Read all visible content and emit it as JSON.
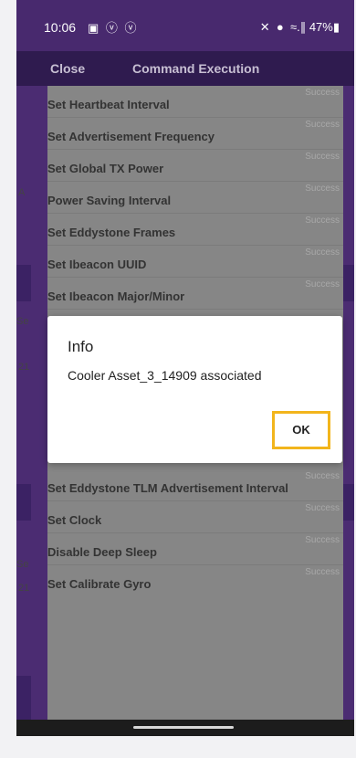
{
  "status_bar": {
    "time": "10:06",
    "left_icons": "▣ ⓥ ⓥ",
    "right_indicators": "✕ ● ≈.∥ 47%▮"
  },
  "app_bar": {
    "close_label": "Close",
    "title": "Command Execution"
  },
  "commands": [
    {
      "name": "Set Heartbeat Interval",
      "status": "Success"
    },
    {
      "name": "Set Advertisement Frequency",
      "status": "Success"
    },
    {
      "name": "Set Global TX Power",
      "status": "Success"
    },
    {
      "name": "Power Saving Interval",
      "status": "Success"
    },
    {
      "name": "Set Eddystone Frames",
      "status": "Success"
    },
    {
      "name": "Set Ibeacon UUID",
      "status": "Success"
    },
    {
      "name": "Set Ibeacon Major/Minor",
      "status": "Success"
    },
    {
      "name": "Set Eddystone TLM Advertisement Interval",
      "status": "Success"
    },
    {
      "name": "Set Clock",
      "status": "Success"
    },
    {
      "name": "Disable Deep Sleep",
      "status": "Success"
    },
    {
      "name": "Set Calibrate Gyro",
      "status": "Success"
    }
  ],
  "dialog": {
    "title": "Info",
    "message": "Cooler Asset_3_14909 associated",
    "ok_label": "OK"
  },
  "background_fragments": [
    "A",
    "Se",
    "21",
    "Se",
    "21"
  ],
  "colors": {
    "app_purple": "#4b2c72",
    "sheet_gray": "#868686",
    "highlight": "#f2b51c"
  }
}
